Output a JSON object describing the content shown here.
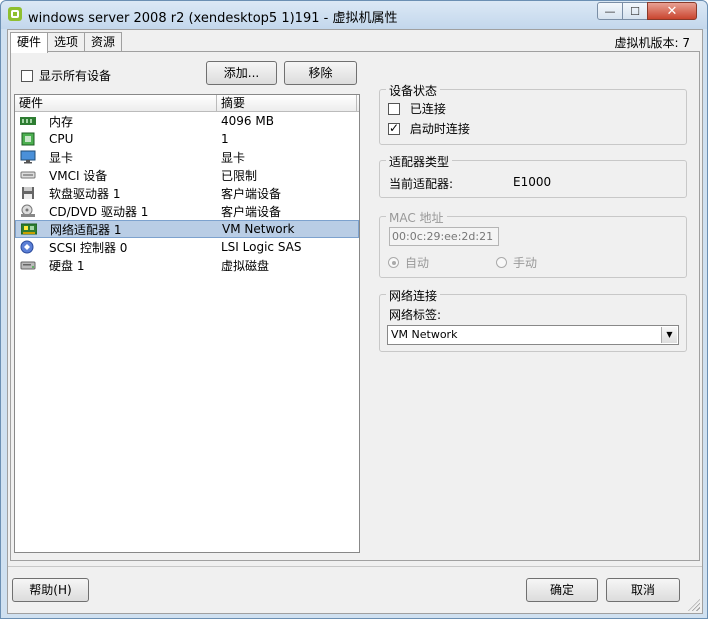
{
  "window": {
    "title": "windows server 2008 r2 (xendesktop5  1)191 - 虚拟机属性",
    "controls": {
      "minimize": "—",
      "maximize": "☐",
      "close": "✕"
    }
  },
  "tabs": [
    {
      "label": "硬件",
      "active": true
    },
    {
      "label": "选项",
      "active": false
    },
    {
      "label": "资源",
      "active": false
    }
  ],
  "vm_version": "虚拟机版本: 7",
  "hardware": {
    "show_all_label": "显示所有设备",
    "show_all_checked": false,
    "add_button": "添加...",
    "remove_button": "移除",
    "columns": [
      "硬件",
      "摘要"
    ],
    "rows": [
      {
        "icon": "memory-icon",
        "name": "内存",
        "summary": "4096 MB"
      },
      {
        "icon": "cpu-icon",
        "name": "CPU",
        "summary": "1"
      },
      {
        "icon": "display-icon",
        "name": "显卡",
        "summary": "显卡"
      },
      {
        "icon": "vmci-icon",
        "name": "VMCI 设备",
        "summary": "已限制"
      },
      {
        "icon": "floppy-icon",
        "name": "软盘驱动器 1",
        "summary": "客户端设备"
      },
      {
        "icon": "cdrom-icon",
        "name": "CD/DVD 驱动器 1",
        "summary": "客户端设备"
      },
      {
        "icon": "network-adapter-icon",
        "name": "网络适配器 1",
        "summary": "VM Network",
        "selected": true
      },
      {
        "icon": "scsi-icon",
        "name": "SCSI 控制器 0",
        "summary": "LSI Logic SAS"
      },
      {
        "icon": "harddisk-icon",
        "name": "硬盘 1",
        "summary": "虚拟磁盘"
      }
    ]
  },
  "device_status": {
    "title": "设备状态",
    "connected_label": "已连接",
    "connected": false,
    "connect_at_power_on_label": "启动时连接",
    "connect_at_power_on": true
  },
  "adapter_type": {
    "title": "适配器类型",
    "current_label": "当前适配器:",
    "current_value": "E1000"
  },
  "mac": {
    "title": "MAC 地址",
    "value": "00:0c:29:ee:2d:21",
    "auto_label": "自动",
    "manual_label": "手动"
  },
  "network": {
    "title": "网络连接",
    "label": "网络标签:",
    "selected": "VM Network"
  },
  "footer": {
    "help_button": "帮助(H)",
    "ok_button": "确定",
    "cancel_button": "取消"
  }
}
